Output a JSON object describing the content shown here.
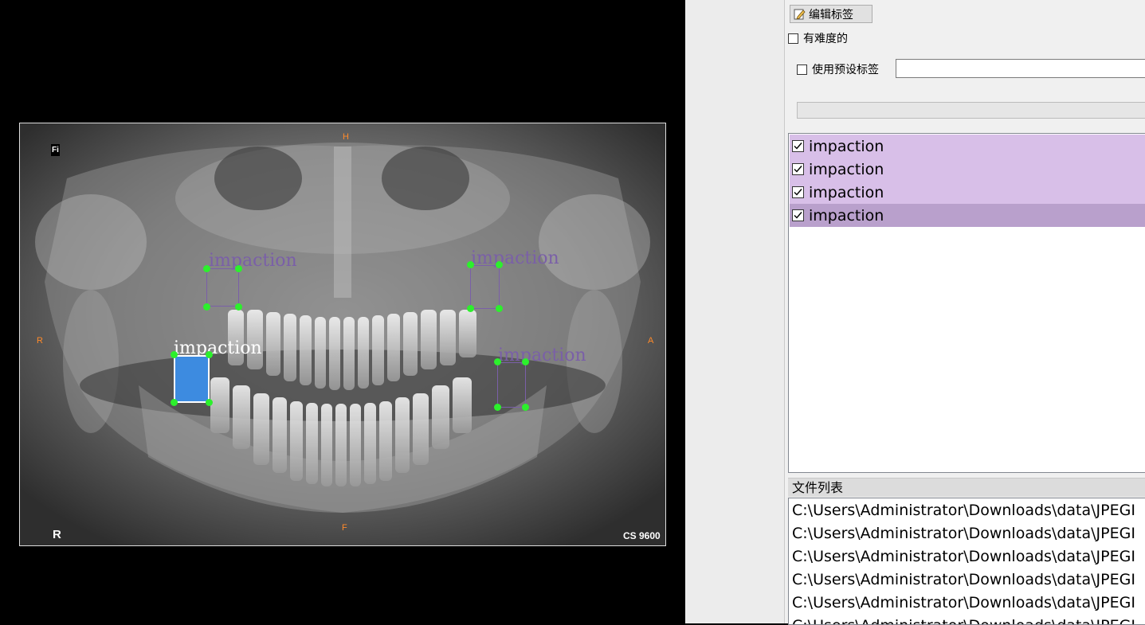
{
  "image": {
    "overlay_marks": {
      "fi": "Fi",
      "r": "R",
      "cs": "CS 9600",
      "top": "H",
      "bottom": "F",
      "left": "R",
      "right": "A"
    }
  },
  "annotations": [
    {
      "label": "impaction",
      "selected": false
    },
    {
      "label": "impaction",
      "selected": false
    },
    {
      "label": "impaction",
      "selected": true
    },
    {
      "label": "impaction",
      "selected": false
    }
  ],
  "panel": {
    "edit_label_button": "编辑标签",
    "difficult_label": "有难度的",
    "use_preset_label": "使用预设标签",
    "preset_value": "",
    "label_list": [
      {
        "text": "impaction",
        "checked": true
      },
      {
        "text": "impaction",
        "checked": true
      },
      {
        "text": "impaction",
        "checked": true
      },
      {
        "text": "impaction",
        "checked": true
      }
    ],
    "file_list_title": "文件列表",
    "files": [
      "C:\\Users\\Administrator\\Downloads\\data\\JPEGI",
      "C:\\Users\\Administrator\\Downloads\\data\\JPEGI",
      "C:\\Users\\Administrator\\Downloads\\data\\JPEGI",
      "C:\\Users\\Administrator\\Downloads\\data\\JPEGI",
      "C:\\Users\\Administrator\\Downloads\\data\\JPEGI",
      "C:\\Users\\Administrator\\Downloads\\data\\JPEGI"
    ]
  },
  "colors": {
    "selected_box_fill": "#3d8be0",
    "box_outline": "#7a5fa8",
    "handle": "#2cf02c",
    "label_row": "#d8bfe8",
    "label_row_selected": "#b9a0cc"
  }
}
